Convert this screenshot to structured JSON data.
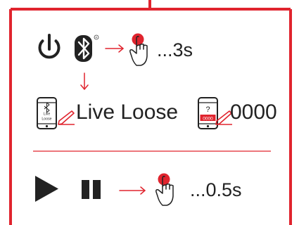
{
  "colors": {
    "accent": "#e0242e",
    "ink": "#222222",
    "background": "#ffffff"
  },
  "icons": {
    "power": "power-icon",
    "bluetooth": "bluetooth-icon",
    "registered": "registered-mark-icon",
    "tap_hand": "tap-hand-icon",
    "phone_bluetooth": "phone-bluetooth-icon",
    "phone_code": "phone-code-icon",
    "pencil": "pencil-icon",
    "play": "play-icon",
    "pause": "pause-icon",
    "arrow": "arrow-icon"
  },
  "instructions": {
    "step1_duration": "...3s",
    "device_name": "Live Loose",
    "phone_screen_text": [
      "Live",
      "Loose"
    ],
    "pin_prompt": "?",
    "pin_screen_text": "0000",
    "pin_code": "0000",
    "step2_duration": "...0.5s"
  }
}
